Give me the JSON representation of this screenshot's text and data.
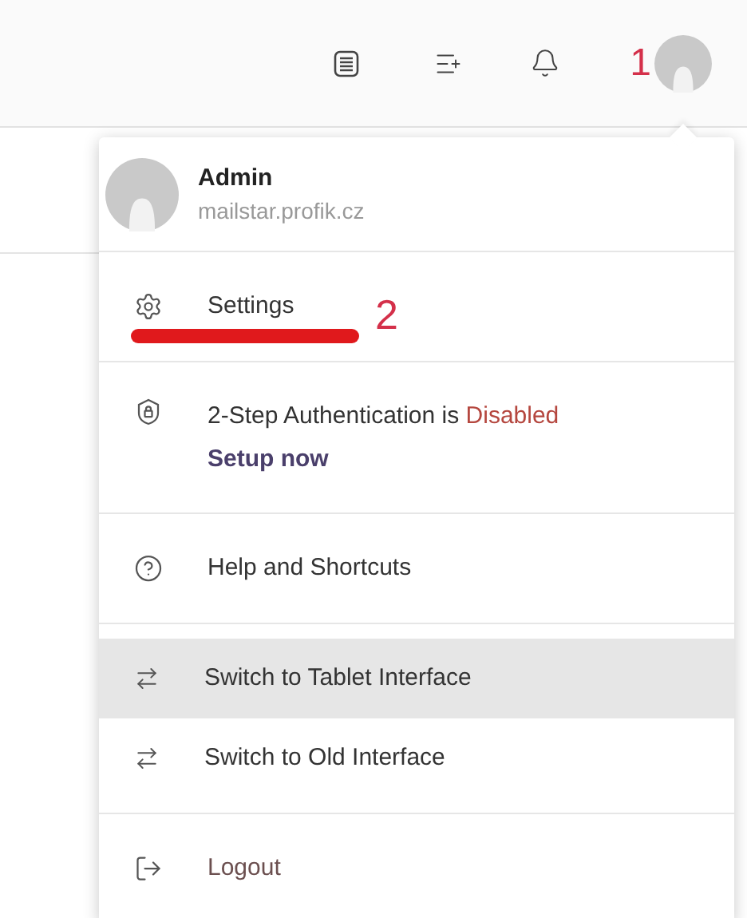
{
  "toolbar": {
    "annotation": "1"
  },
  "menu": {
    "user": {
      "name": "Admin",
      "domain": "mailstar.profik.cz"
    },
    "sections": [
      {
        "items": [
          {
            "kind": "settings",
            "label": "Settings",
            "selected": false,
            "annotation": "2"
          }
        ]
      },
      {
        "items": [
          {
            "kind": "auth",
            "label": "2-Step Authentication is",
            "status": "Disabled",
            "action": "Setup now",
            "selected": false
          }
        ]
      },
      {
        "items": [
          {
            "kind": "help",
            "label": "Help and Shortcuts",
            "selected": false
          }
        ]
      },
      {
        "items": [
          {
            "kind": "switch",
            "label": "Switch to Tablet Interface",
            "selected": true
          },
          {
            "kind": "switch",
            "label": "Switch to Old Interface",
            "selected": false
          }
        ]
      },
      {
        "items": [
          {
            "kind": "logout",
            "label": "Logout",
            "selected": false
          }
        ]
      }
    ]
  }
}
